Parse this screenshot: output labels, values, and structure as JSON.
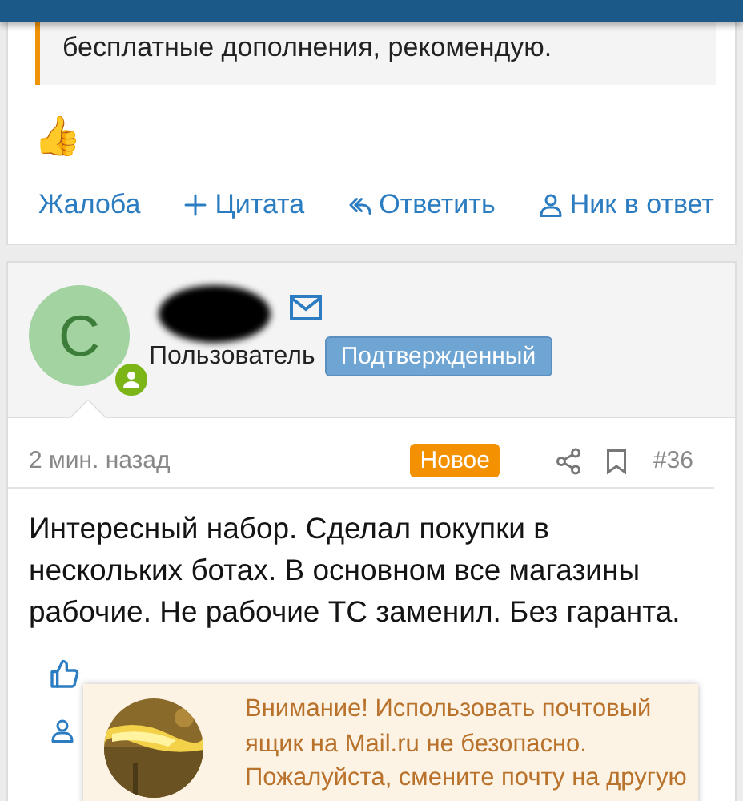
{
  "quote": {
    "text": "бесплатные дополнения, рекомендую."
  },
  "reaction": {
    "emoji": "👍"
  },
  "actions": [
    {
      "kind": "report",
      "label": "Жалоба"
    },
    {
      "kind": "quote",
      "label": "Цитата"
    },
    {
      "kind": "reply",
      "label": "Ответить"
    },
    {
      "kind": "mention",
      "label": "Ник в ответ"
    }
  ],
  "post": {
    "avatar_letter": "С",
    "role": "Пользователь",
    "badge": "Подтвержденный",
    "time": "2 мин. назад",
    "new_label": "Новое",
    "number": "#36",
    "text": "Интересный набор. Сделал покупки в нескольких ботах. В основном все магазины рабочие. Не рабочие ТС заменил. Без гаранта.",
    "actions": [
      {
        "kind": "like"
      },
      {
        "kind": "mention"
      }
    ]
  },
  "notice": {
    "text": "Внимание! Использовать почтовый ящик на Mail.ru не безопасно. Пожалуйста, смените почту на другую"
  }
}
